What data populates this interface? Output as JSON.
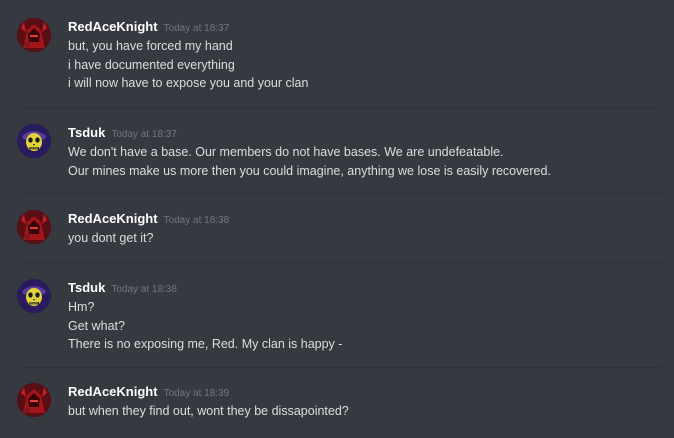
{
  "messages": [
    {
      "author": "RedAceKnight",
      "timestamp": "Today at 18:37",
      "avatar_icon": "red-knight-avatar-icon",
      "lines": [
        "but, you have forced my hand",
        "i have documented everything",
        "i will now have to expose you and your clan"
      ]
    },
    {
      "author": "Tsduk",
      "timestamp": "Today at 18:37",
      "avatar_icon": "skeletor-avatar-icon",
      "lines": [
        "We don't have a base. Our members do not have bases. We are undefeatable.",
        "Our mines make us more then you could imagine, anything we lose is easily recovered."
      ]
    },
    {
      "author": "RedAceKnight",
      "timestamp": "Today at 18:38",
      "avatar_icon": "red-knight-avatar-icon",
      "lines": [
        "you dont get it?"
      ]
    },
    {
      "author": "Tsduk",
      "timestamp": "Today at 18:38",
      "avatar_icon": "skeletor-avatar-icon",
      "lines": [
        "Hm?",
        "Get what?",
        "There is no exposing me, Red. My clan is happy -"
      ]
    },
    {
      "author": "RedAceKnight",
      "timestamp": "Today at 18:39",
      "avatar_icon": "red-knight-avatar-icon",
      "lines": [
        "but when they find out, wont they be dissapointed?"
      ]
    }
  ],
  "colors": {
    "background": "#36393f",
    "author": "#ffffff",
    "timestamp": "#72767d",
    "text": "#dcddde",
    "divider": "#2f3136"
  }
}
